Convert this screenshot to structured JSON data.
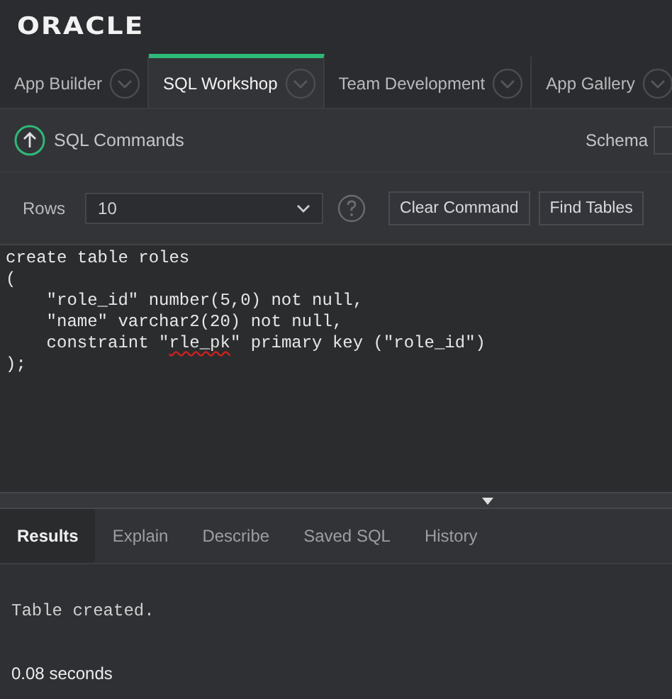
{
  "header": {
    "logo": "ORACLE"
  },
  "tabs": [
    {
      "label": "App Builder",
      "selected": false
    },
    {
      "label": "SQL Workshop",
      "selected": true
    },
    {
      "label": "Team Development",
      "selected": false
    },
    {
      "label": "App Gallery",
      "selected": false
    }
  ],
  "page": {
    "title": "SQL Commands",
    "schema_label": "Schema"
  },
  "toolbar": {
    "rows_label": "Rows",
    "rows_value": "10",
    "buttons": [
      "Clear Command",
      "Find Tables"
    ]
  },
  "editor": {
    "lines": [
      [
        {
          "text": "create table roles"
        }
      ],
      [
        {
          "text": "("
        }
      ],
      [
        {
          "text": "    \"role_id\" number(5,0) not null,"
        }
      ],
      [
        {
          "text": "    \"name\" varchar2(20) not null,"
        }
      ],
      [
        {
          "text": "    constraint \""
        },
        {
          "text": "rle_pk",
          "misspelled": true
        },
        {
          "text": "\" primary key (\"role_id\")"
        }
      ],
      [
        {
          "text": ");"
        }
      ]
    ]
  },
  "result_tabs": [
    {
      "label": "Results",
      "selected": true
    },
    {
      "label": "Explain",
      "selected": false
    },
    {
      "label": "Describe",
      "selected": false
    },
    {
      "label": "Saved SQL",
      "selected": false
    },
    {
      "label": "History",
      "selected": false
    }
  ],
  "results": {
    "message": "Table created.",
    "time": "0.08 seconds"
  }
}
